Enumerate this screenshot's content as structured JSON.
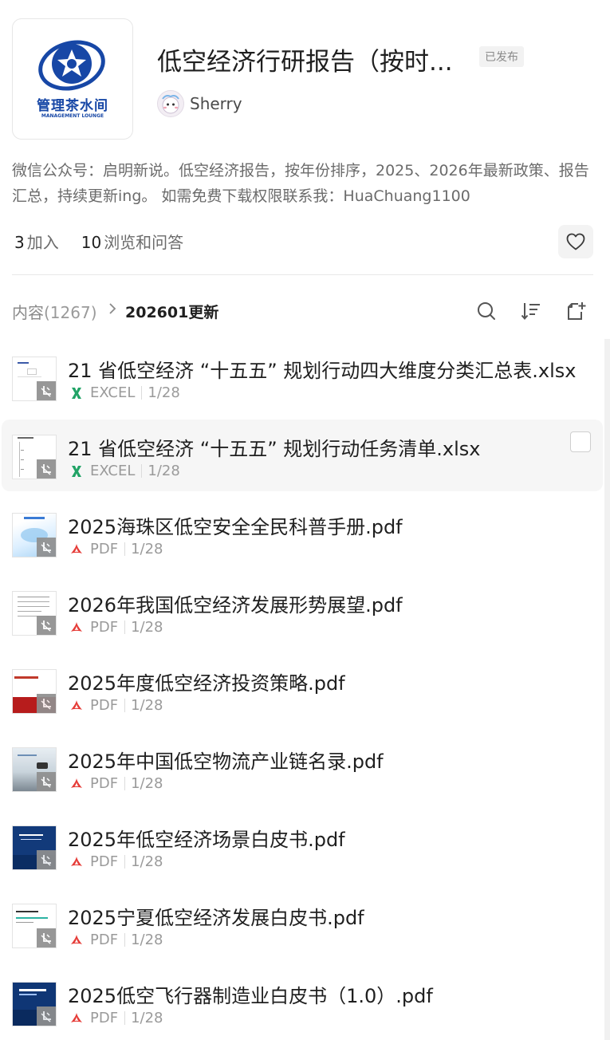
{
  "knowledge_base": {
    "logo_text": "管理茶水间",
    "logo_subtext": "MANAGEMENT LOUNGE",
    "title": "低空经济行研报告（按时...",
    "status": "已发布",
    "author": "Sherry",
    "description": "微信公众号：启明新说。低空经济报告，按年份排序，2025、2026年最新政策、报告汇总，持续更新ing。 如需免费下载权限联系我：HuaChuang1100",
    "stats": {
      "joined_count": "3",
      "joined_label": "加入",
      "views_count": "10",
      "views_label": "浏览和问答"
    }
  },
  "toolbar": {
    "root_label": "内容",
    "root_count": "(1267)",
    "current_folder": "202601更新",
    "icons": [
      "search-icon",
      "sort-icon",
      "new-doc-icon"
    ]
  },
  "files": [
    {
      "name": "21 省低空经济 “十五五” 规划行动四大维度分类汇总表.xlsx",
      "type": "EXCEL",
      "date": "1/28",
      "thumb": "sheet"
    },
    {
      "name": "21 省低空经济 “十五五” 规划行动任务清单.xlsx",
      "type": "EXCEL",
      "date": "1/28",
      "thumb": "sheet2"
    },
    {
      "name": "2025海珠区低空安全全民科普手册.pdf",
      "type": "PDF",
      "date": "1/28",
      "thumb": "lightblue"
    },
    {
      "name": "2026年我国低空经济发展形势展望.pdf",
      "type": "PDF",
      "date": "1/28",
      "thumb": "text"
    },
    {
      "name": "2025年度低空经济投资策略.pdf",
      "type": "PDF",
      "date": "1/28",
      "thumb": "red"
    },
    {
      "name": "2025年中国低空物流产业链名录.pdf",
      "type": "PDF",
      "date": "1/28",
      "thumb": "photo"
    },
    {
      "name": "2025年低空经济场景白皮书.pdf",
      "type": "PDF",
      "date": "1/28",
      "thumb": "navy"
    },
    {
      "name": "2025宁夏低空经济发展白皮书.pdf",
      "type": "PDF",
      "date": "1/28",
      "thumb": "whitegreen"
    },
    {
      "name": "2025低空飞行器制造业白皮书（1.0）.pdf",
      "type": "PDF",
      "date": "1/28",
      "thumb": "navy2"
    }
  ],
  "colors": {
    "excel": "#21a366",
    "pdf": "#e53935",
    "logo_blue": "#1747a6",
    "text_primary": "#1f1f1f",
    "text_secondary": "#9a9a9a"
  }
}
